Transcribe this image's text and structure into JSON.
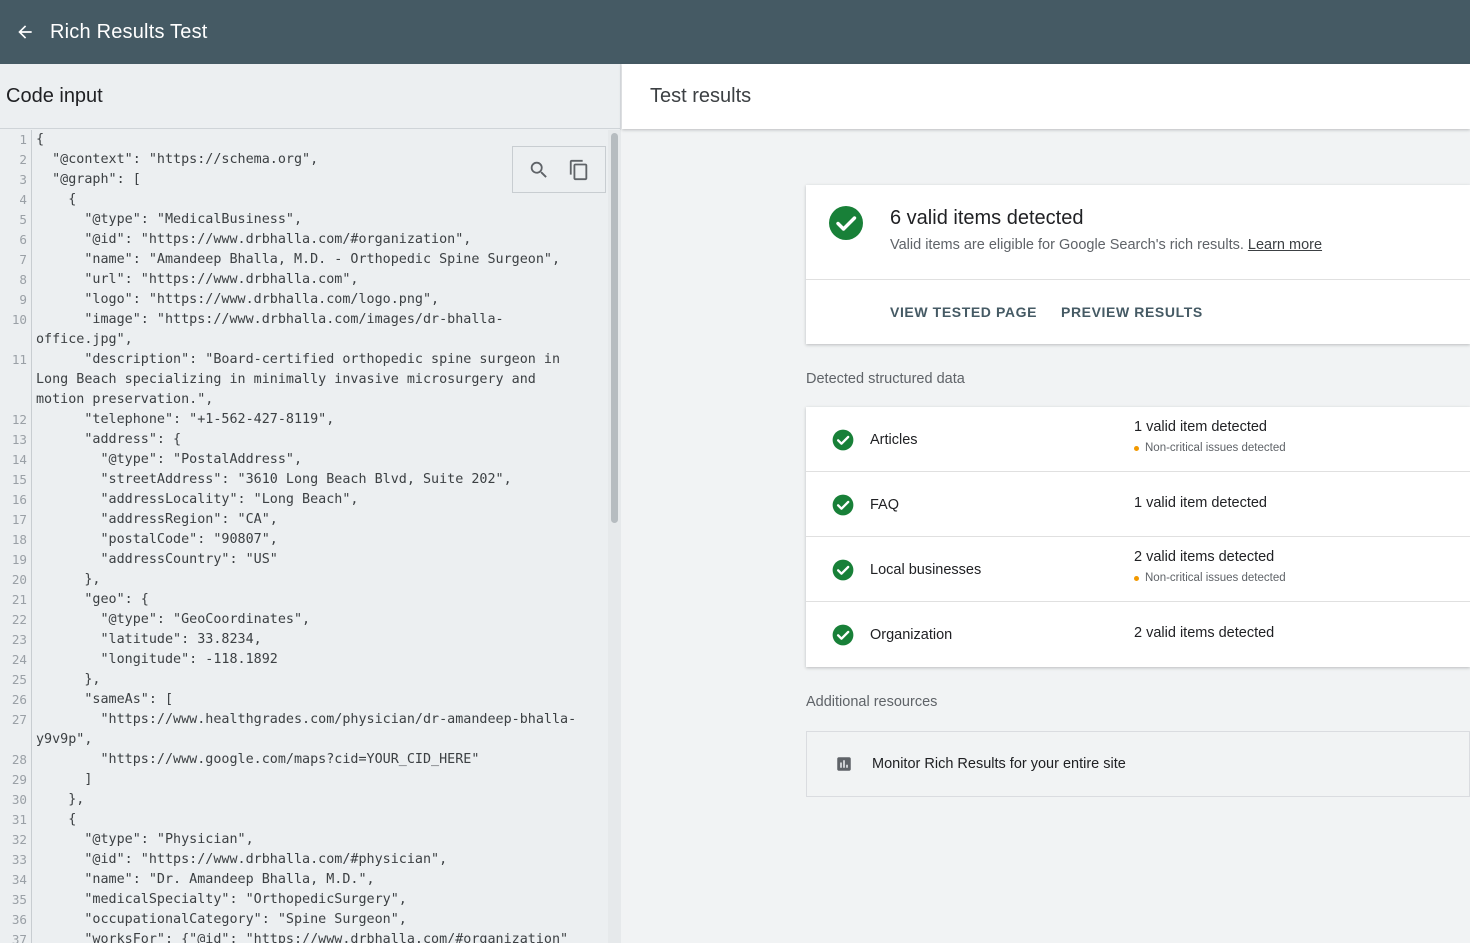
{
  "header": {
    "title": "Rich Results Test"
  },
  "code_panel": {
    "title": "Code input",
    "lines": [
      {
        "n": "1",
        "text": "{"
      },
      {
        "n": "2",
        "text": "  \"@context\": \"https://schema.org\","
      },
      {
        "n": "3",
        "text": "  \"@graph\": ["
      },
      {
        "n": "4",
        "text": "    {"
      },
      {
        "n": "5",
        "text": "      \"@type\": \"MedicalBusiness\","
      },
      {
        "n": "6",
        "text": "      \"@id\": \"https://www.drbhalla.com/#organization\","
      },
      {
        "n": "7",
        "text": "      \"name\": \"Amandeep Bhalla, M.D. - Orthopedic Spine Surgeon\","
      },
      {
        "n": "8",
        "text": "      \"url\": \"https://www.drbhalla.com\","
      },
      {
        "n": "9",
        "text": "      \"logo\": \"https://www.drbhalla.com/logo.png\","
      },
      {
        "n": "10",
        "text": "      \"image\": \"https://www.drbhalla.com/images/dr-bhalla-",
        "cont": [
          "office.jpg\","
        ]
      },
      {
        "n": "11",
        "text": "      \"description\": \"Board-certified orthopedic spine surgeon in",
        "cont": [
          "Long Beach specializing in minimally invasive microsurgery and",
          "motion preservation.\","
        ]
      },
      {
        "n": "12",
        "text": "      \"telephone\": \"+1-562-427-8119\","
      },
      {
        "n": "13",
        "text": "      \"address\": {"
      },
      {
        "n": "14",
        "text": "        \"@type\": \"PostalAddress\","
      },
      {
        "n": "15",
        "text": "        \"streetAddress\": \"3610 Long Beach Blvd, Suite 202\","
      },
      {
        "n": "16",
        "text": "        \"addressLocality\": \"Long Beach\","
      },
      {
        "n": "17",
        "text": "        \"addressRegion\": \"CA\","
      },
      {
        "n": "18",
        "text": "        \"postalCode\": \"90807\","
      },
      {
        "n": "19",
        "text": "        \"addressCountry\": \"US\""
      },
      {
        "n": "20",
        "text": "      },"
      },
      {
        "n": "21",
        "text": "      \"geo\": {"
      },
      {
        "n": "22",
        "text": "        \"@type\": \"GeoCoordinates\","
      },
      {
        "n": "23",
        "text": "        \"latitude\": 33.8234,"
      },
      {
        "n": "24",
        "text": "        \"longitude\": -118.1892"
      },
      {
        "n": "25",
        "text": "      },"
      },
      {
        "n": "26",
        "text": "      \"sameAs\": ["
      },
      {
        "n": "27",
        "text": "        \"https://www.healthgrades.com/physician/dr-amandeep-bhalla-",
        "cont": [
          "y9v9p\","
        ]
      },
      {
        "n": "28",
        "text": "        \"https://www.google.com/maps?cid=YOUR_CID_HERE\""
      },
      {
        "n": "29",
        "text": "      ]"
      },
      {
        "n": "30",
        "text": "    },"
      },
      {
        "n": "31",
        "text": "    {"
      },
      {
        "n": "32",
        "text": "      \"@type\": \"Physician\","
      },
      {
        "n": "33",
        "text": "      \"@id\": \"https://www.drbhalla.com/#physician\","
      },
      {
        "n": "34",
        "text": "      \"name\": \"Dr. Amandeep Bhalla, M.D.\","
      },
      {
        "n": "35",
        "text": "      \"medicalSpecialty\": \"OrthopedicSurgery\","
      },
      {
        "n": "36",
        "text": "      \"occupationalCategory\": \"Spine Surgeon\","
      },
      {
        "n": "37",
        "text": "      \"worksFor\": {\"@id\": \"https://www.drbhalla.com/#organization\""
      }
    ]
  },
  "results": {
    "title": "Test results",
    "summary": {
      "heading": "6 valid items detected",
      "description": "Valid items are eligible for Google Search's rich results.",
      "learn_more": "Learn more",
      "view_tested_page": "VIEW TESTED PAGE",
      "preview_results": "PREVIEW RESULTS"
    },
    "detected_label": "Detected structured data",
    "items": [
      {
        "label": "Articles",
        "status": "1 valid item detected",
        "issue": "Non-critical issues detected"
      },
      {
        "label": "FAQ",
        "status": "1 valid item detected"
      },
      {
        "label": "Local businesses",
        "status": "2 valid items detected",
        "issue": "Non-critical issues detected"
      },
      {
        "label": "Organization",
        "status": "2 valid items detected"
      }
    ],
    "additional_label": "Additional resources",
    "resource": "Monitor Rich Results for your entire site"
  },
  "colors": {
    "header_bg": "#455a64",
    "valid_green": "#188038",
    "warning_orange": "#f29900"
  },
  "icons": [
    "arrow-back-icon",
    "search-icon",
    "copy-icon",
    "check-circle-icon",
    "bar-chart-icon"
  ]
}
